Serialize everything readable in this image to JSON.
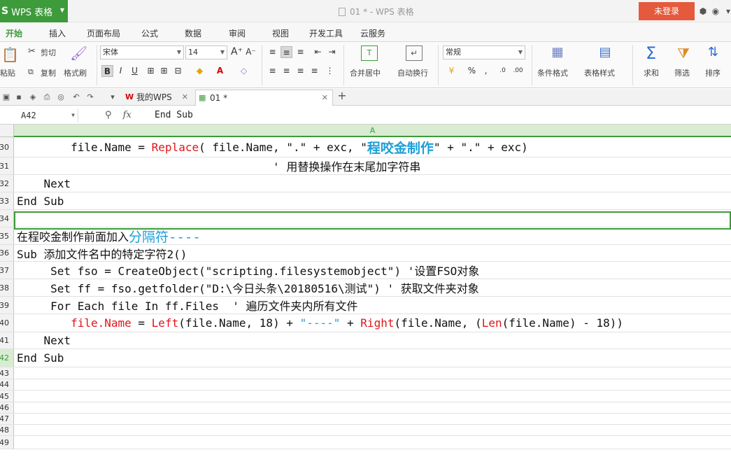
{
  "app": {
    "logo": "S",
    "name": "WPS 表格"
  },
  "window": {
    "title": "01 * - WPS 表格",
    "login_label": "未登录"
  },
  "menu": [
    "开始",
    "插入",
    "页面布局",
    "公式",
    "数据",
    "审阅",
    "视图",
    "开发工具",
    "云服务"
  ],
  "ribbon": {
    "paste": "粘贴",
    "cut": "剪切",
    "copy": "复制",
    "format_painter": "格式刷",
    "font_name": "宋体",
    "font_size": "14",
    "merge_center": "合并居中",
    "wrap_text": "自动换行",
    "number_format": "常规",
    "cond_format": "条件格式",
    "table_style": "表格样式",
    "sum": "求和",
    "filter": "筛选",
    "sort": "排序",
    "percent": "%"
  },
  "tabs": {
    "home": "我的WPS",
    "doc": "01 *"
  },
  "formula_bar": {
    "cell_ref": "A42",
    "fx": "fx",
    "content": "End Sub"
  },
  "column_header": "A",
  "rows": [
    {
      "num": "30",
      "segments": [
        {
          "t": "        file.Name = "
        },
        {
          "t": "Replace",
          "c": "red"
        },
        {
          "t": "( file.Name, \".\" + exc, \""
        },
        {
          "t": "程咬金制作",
          "c": "bigblue"
        },
        {
          "t": "\" + \".\" + exc)"
        }
      ]
    },
    {
      "num": "31",
      "segments": [
        {
          "t": "                                      ' 用替换操作在末尾加字符串"
        }
      ]
    },
    {
      "num": "32",
      "segments": [
        {
          "t": "    Next"
        }
      ]
    },
    {
      "num": "33",
      "segments": [
        {
          "t": "End Sub"
        }
      ]
    },
    {
      "num": "34",
      "segments": []
    },
    {
      "num": "35",
      "segments": [
        {
          "t": "在程咬金制作前面加入"
        },
        {
          "t": "分隔符----",
          "c": "bigblue2"
        }
      ]
    },
    {
      "num": "36",
      "segments": [
        {
          "t": "Sub 添加文件名中的特定字符2()"
        }
      ]
    },
    {
      "num": "37",
      "segments": [
        {
          "t": "     Set fso = CreateObject(\"scripting.filesystemobject\") '设置FSO对象"
        }
      ]
    },
    {
      "num": "38",
      "segments": [
        {
          "t": "     Set ff = fso.getfolder(\"D:\\今日头条\\20180516\\测试\") ' 获取文件夹对象"
        }
      ]
    },
    {
      "num": "39",
      "segments": [
        {
          "t": "     For Each file In ff.Files  ' 遍历文件夹内所有文件"
        }
      ]
    },
    {
      "num": "40",
      "segments": [
        {
          "t": "        "
        },
        {
          "t": "file.Name",
          "c": "red"
        },
        {
          "t": " = "
        },
        {
          "t": "Left",
          "c": "red"
        },
        {
          "t": "(file.Name, 18) + "
        },
        {
          "t": "\"----\"",
          "c": "blue"
        },
        {
          "t": " + "
        },
        {
          "t": "Right",
          "c": "red"
        },
        {
          "t": "(file.Name, ("
        },
        {
          "t": "Len",
          "c": "red"
        },
        {
          "t": "(file.Name) - 18))"
        }
      ]
    },
    {
      "num": "41",
      "segments": [
        {
          "t": "    Next"
        }
      ]
    },
    {
      "num": "42",
      "segments": [
        {
          "t": "End Sub"
        }
      ]
    },
    {
      "num": "43",
      "segments": []
    },
    {
      "num": "44",
      "segments": []
    },
    {
      "num": "45",
      "segments": []
    },
    {
      "num": "46",
      "segments": []
    },
    {
      "num": "47",
      "segments": []
    },
    {
      "num": "48",
      "segments": []
    },
    {
      "num": "49",
      "segments": []
    }
  ]
}
